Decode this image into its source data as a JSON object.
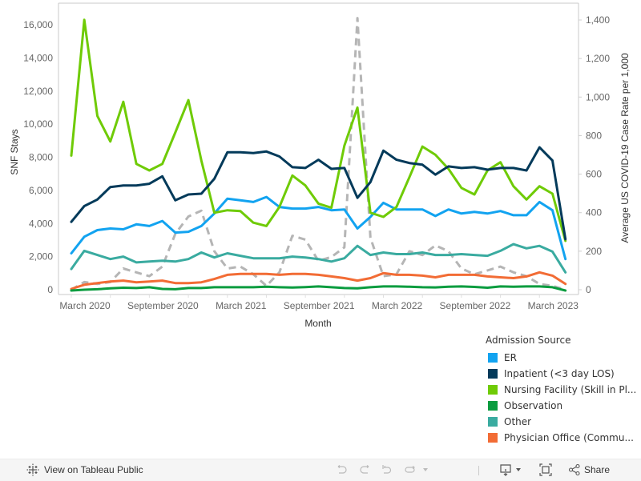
{
  "chart_data": {
    "type": "line",
    "title": "",
    "xlabel": "Month",
    "ylabel": "SNF Stays",
    "y2label": "Average US COVID-19 Case Rate per 1,000",
    "ylim": [
      0,
      16500
    ],
    "y2lim": [
      0,
      1450
    ],
    "yticks": [
      "0",
      "2,000",
      "4,000",
      "6,000",
      "8,000",
      "10,000",
      "12,000",
      "14,000",
      "16,000"
    ],
    "ytick_values": [
      0,
      2000,
      4000,
      6000,
      8000,
      10000,
      12000,
      14000,
      16000
    ],
    "y2ticks": [
      "0",
      "200",
      "400",
      "600",
      "800",
      "1,000",
      "1,200",
      "1,400"
    ],
    "y2tick_values": [
      0,
      200,
      400,
      600,
      800,
      1000,
      1200,
      1400
    ],
    "xtick_labels": [
      "March 2020",
      "September 2020",
      "March 2021",
      "September 2021",
      "March 2022",
      "September 2022",
      "March 2023"
    ],
    "xtick_indices": [
      0,
      6,
      12,
      18,
      24,
      30,
      36
    ],
    "x": [
      "2020-03",
      "2020-04",
      "2020-05",
      "2020-06",
      "2020-07",
      "2020-08",
      "2020-09",
      "2020-10",
      "2020-11",
      "2020-12",
      "2021-01",
      "2021-02",
      "2021-03",
      "2021-04",
      "2021-05",
      "2021-06",
      "2021-07",
      "2021-08",
      "2021-09",
      "2021-10",
      "2021-11",
      "2021-12",
      "2022-01",
      "2022-02",
      "2022-03",
      "2022-04",
      "2022-05",
      "2022-06",
      "2022-07",
      "2022-08",
      "2022-09",
      "2022-10",
      "2022-11",
      "2022-12",
      "2023-01",
      "2023-02",
      "2023-03",
      "2023-04",
      "2023-05"
    ],
    "grid": false,
    "legend_position": "bottom-right",
    "legend_title": "Admission Source",
    "series": [
      {
        "name": "ER",
        "color": "#12a3f0",
        "axis": "left",
        "values": [
          2200,
          3200,
          3600,
          3700,
          3650,
          3950,
          3850,
          4150,
          3450,
          3500,
          3850,
          4600,
          5500,
          5400,
          5300,
          5600,
          5000,
          4900,
          4900,
          5000,
          4800,
          4850,
          3700,
          4400,
          5250,
          4850,
          4850,
          4850,
          4450,
          4850,
          4600,
          4700,
          4600,
          4750,
          4500,
          4500,
          5300,
          4800,
          1850
        ]
      },
      {
        "name": "Inpatient (<3 day LOS)",
        "color": "#033a5a",
        "axis": "left",
        "values": [
          4100,
          5050,
          5450,
          6200,
          6300,
          6300,
          6400,
          6850,
          5400,
          5750,
          5800,
          6700,
          8300,
          8300,
          8250,
          8350,
          8050,
          7400,
          7350,
          7850,
          7300,
          7350,
          5550,
          6500,
          8400,
          7850,
          7650,
          7550,
          6950,
          7450,
          7350,
          7400,
          7250,
          7350,
          7350,
          7200,
          8600,
          7800,
          3050
        ]
      },
      {
        "name": "Nursing Facility (Skill in Pl...",
        "color": "#6fcb06",
        "axis": "left",
        "values": [
          8100,
          16300,
          10500,
          8950,
          11350,
          7600,
          7200,
          7600,
          9500,
          11450,
          7800,
          4650,
          4800,
          4750,
          4050,
          3850,
          5000,
          6900,
          6300,
          5200,
          4950,
          8700,
          11000,
          4650,
          4400,
          5000,
          6800,
          8650,
          8150,
          7300,
          6150,
          5750,
          7200,
          7700,
          6250,
          5450,
          6250,
          5800,
          2950
        ]
      },
      {
        "name": "Observation",
        "color": "#0a9c3f",
        "axis": "left",
        "values": [
          -50,
          0,
          30,
          80,
          120,
          100,
          150,
          50,
          30,
          100,
          100,
          150,
          150,
          150,
          150,
          180,
          150,
          130,
          160,
          200,
          150,
          100,
          80,
          150,
          200,
          200,
          180,
          150,
          140,
          180,
          200,
          170,
          120,
          200,
          180,
          200,
          200,
          150,
          -50
        ]
      },
      {
        "name": "Other",
        "color": "#3aaba0",
        "axis": "left",
        "values": [
          1250,
          2350,
          2100,
          1850,
          2000,
          1650,
          1700,
          1750,
          1700,
          1850,
          2250,
          1950,
          2200,
          2050,
          1900,
          1900,
          1900,
          2000,
          1950,
          1850,
          1700,
          1900,
          2650,
          2100,
          2250,
          2150,
          2150,
          2250,
          2100,
          2100,
          2150,
          2100,
          2050,
          2350,
          2750,
          2500,
          2650,
          2300,
          1050
        ]
      },
      {
        "name": "Physician Office (Commu...",
        "color": "#f26c35",
        "axis": "left",
        "values": [
          50,
          300,
          400,
          500,
          550,
          450,
          500,
          550,
          400,
          400,
          450,
          650,
          900,
          950,
          950,
          950,
          900,
          950,
          950,
          900,
          800,
          700,
          550,
          700,
          1000,
          900,
          900,
          850,
          750,
          900,
          900,
          900,
          800,
          750,
          700,
          800,
          1050,
          850,
          350
        ]
      },
      {
        "name": "Average US COVID-19 Case Rate per 1,000",
        "color": "#b5b5b5",
        "axis": "right",
        "dashed": true,
        "values": [
          0,
          40,
          30,
          40,
          110,
          90,
          70,
          120,
          290,
          380,
          410,
          200,
          110,
          120,
          80,
          20,
          90,
          280,
          260,
          150,
          170,
          220,
          1410,
          270,
          70,
          80,
          200,
          180,
          230,
          200,
          110,
          80,
          100,
          120,
          90,
          70,
          30,
          20,
          0
        ]
      }
    ]
  },
  "legend": {
    "title": "Admission Source",
    "items": [
      {
        "label": "ER",
        "color": "#12a3f0"
      },
      {
        "label": "Inpatient (<3 day LOS)",
        "color": "#033a5a"
      },
      {
        "label": "Nursing Facility (Skill in Pl...",
        "color": "#6fcb06"
      },
      {
        "label": "Observation",
        "color": "#0a9c3f"
      },
      {
        "label": "Other",
        "color": "#3aaba0"
      },
      {
        "label": "Physician Office (Commu...",
        "color": "#f26c35"
      }
    ]
  },
  "toolbar": {
    "view_on_label": "View on Tableau Public",
    "view_on_icon": "tableau-logo-icon",
    "undo_icon": "undo-icon",
    "redo_icon": "redo-icon",
    "revert_icon": "revert-icon",
    "refresh_icon": "refresh-icon",
    "download_icon": "download-icon",
    "fullscreen_icon": "fullscreen-icon",
    "share_icon": "share-icon",
    "share_label": "Share"
  }
}
